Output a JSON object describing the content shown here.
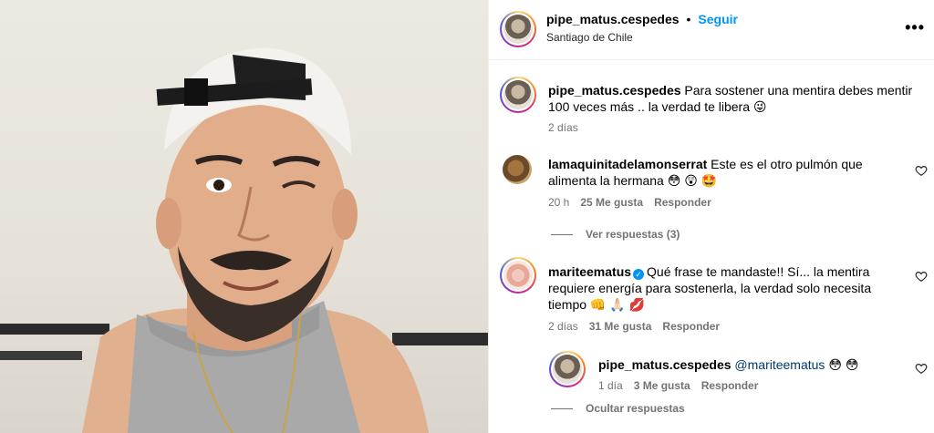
{
  "header": {
    "username": "pipe_matus.cespedes",
    "separator": "•",
    "follow_label": "Seguir",
    "location": "Santiago de Chile",
    "more_label": "•••"
  },
  "caption": {
    "username": "pipe_matus.cespedes",
    "text": "Para sostener una mentira debes mentir 100 veces más .. la verdad te libera 😜",
    "time": "2 días"
  },
  "comments": [
    {
      "username": "lamaquinitadelamonserrat",
      "text_line1": "Este es el otro pulmón que",
      "text_line2": "alimenta la hermana 😳 😲 🤩",
      "time": "20 h",
      "likes": "25 Me gusta",
      "reply_label": "Responder",
      "view_replies": "Ver respuestas (3)"
    },
    {
      "username": "mariteematus",
      "text_line1": "Qué frase te mandaste!! Sí... la mentira",
      "text_line2": "requiere energía para sostenerla, la verdad solo necesita",
      "text_line3": "tiempo 👊 🙏🏻 💋",
      "time": "2 días",
      "likes": "31 Me gusta",
      "reply_label": "Responder",
      "hide_replies": "Ocultar respuestas"
    }
  ],
  "reply": {
    "username": "pipe_matus.cespedes",
    "mention": "@mariteematus",
    "emojis": "😳 😳",
    "time": "1 día",
    "likes": "3 Me gusta",
    "reply_label": "Responder"
  }
}
